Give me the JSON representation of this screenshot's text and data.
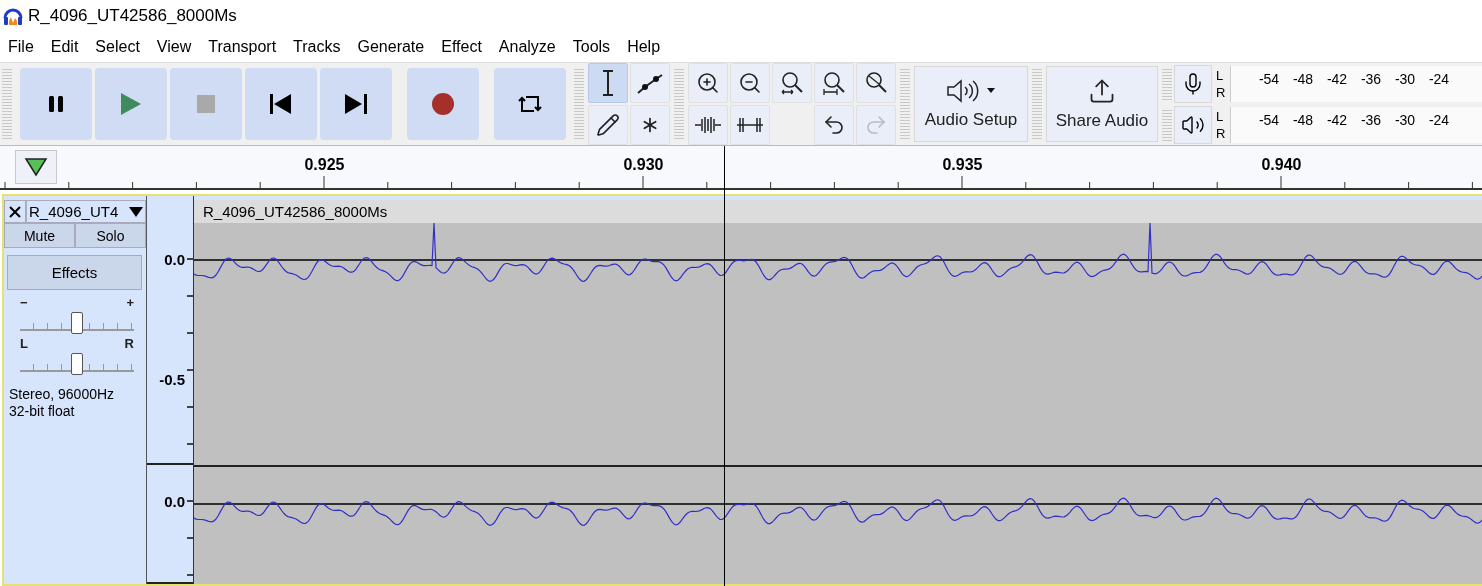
{
  "window": {
    "title": "R_4096_UT42586_8000Ms"
  },
  "menu": [
    "File",
    "Edit",
    "Select",
    "View",
    "Transport",
    "Tracks",
    "Generate",
    "Effect",
    "Analyze",
    "Tools",
    "Help"
  ],
  "transport": [
    {
      "kind": "pause"
    },
    {
      "kind": "play"
    },
    {
      "kind": "stop"
    },
    {
      "kind": "skip-start"
    },
    {
      "kind": "skip-end"
    },
    {
      "kind": "record"
    },
    {
      "kind": "loop"
    }
  ],
  "tools": [
    {
      "kind": "select",
      "selected": true
    },
    {
      "kind": "envelope",
      "selected": false
    },
    {
      "kind": "draw",
      "selected": false
    },
    {
      "kind": "multi",
      "selected": false
    }
  ],
  "edit_tools": [
    {
      "kind": "zoom-in",
      "disabled": false
    },
    {
      "kind": "zoom-out",
      "disabled": false
    },
    {
      "kind": "fit-selection",
      "disabled": false
    },
    {
      "kind": "fit-project",
      "disabled": false
    },
    {
      "kind": "zoom-toggle",
      "disabled": false
    },
    {
      "kind": "trim",
      "disabled": false
    },
    {
      "kind": "silence",
      "disabled": false
    },
    {
      "kind": "blank"
    },
    {
      "kind": "undo",
      "disabled": false
    },
    {
      "kind": "redo",
      "disabled": true
    }
  ],
  "audio_setup": {
    "label": "Audio Setup"
  },
  "share_audio": {
    "label": "Share Audio"
  },
  "meters": [
    {
      "kind": "record",
      "channels": [
        "L",
        "R"
      ],
      "scale": [
        "-54",
        "-48",
        "-42",
        "-36",
        "-30",
        "-24"
      ]
    },
    {
      "kind": "playback",
      "channels": [
        "L",
        "R"
      ],
      "scale": [
        "-54",
        "-48",
        "-42",
        "-36",
        "-30",
        "-24"
      ]
    }
  ],
  "timeline": {
    "ticks": [
      "0.925",
      "0.930",
      "0.935",
      "0.940"
    ]
  },
  "track": {
    "name": "R_4096_UT4",
    "clip_title": "R_4096_UT42586_8000Ms",
    "mute": "Mute",
    "solo": "Solo",
    "effects": "Effects",
    "gain": {
      "minus": "−",
      "plus": "+",
      "level": 0.5
    },
    "pan": {
      "left": "L",
      "right": "R",
      "level": 0.5
    },
    "info": [
      "Stereo, 96000Hz",
      "32-bit float"
    ],
    "channels": [
      {
        "labels": [
          "0.0",
          "-0.5"
        ]
      },
      {
        "labels": [
          "0.0"
        ]
      }
    ]
  }
}
